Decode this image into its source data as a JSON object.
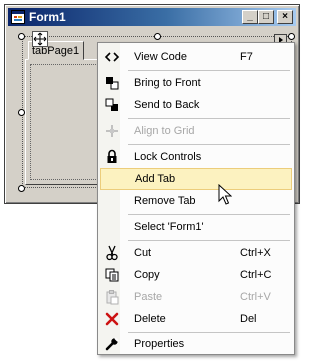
{
  "window": {
    "title": "Form1",
    "buttons": {
      "minimize": "_",
      "maximize": "□",
      "close": "×"
    }
  },
  "designer": {
    "tab_label": "tabPage1"
  },
  "context_menu": {
    "items": [
      {
        "label": "View Code",
        "shortcut": "F7",
        "icon": "view-code-icon",
        "enabled": true
      },
      {
        "label": "Bring to Front",
        "shortcut": "",
        "icon": "bring-to-front-icon",
        "enabled": true
      },
      {
        "label": "Send to Back",
        "shortcut": "",
        "icon": "send-to-back-icon",
        "enabled": true
      },
      {
        "label": "Align to Grid",
        "shortcut": "",
        "icon": "align-to-grid-icon",
        "enabled": false
      },
      {
        "label": "Lock Controls",
        "shortcut": "",
        "icon": "lock-icon",
        "enabled": true
      },
      {
        "label": "Add Tab",
        "shortcut": "",
        "icon": "",
        "enabled": true,
        "highlighted": true
      },
      {
        "label": "Remove Tab",
        "shortcut": "",
        "icon": "",
        "enabled": true
      },
      {
        "label": "Select 'Form1'",
        "shortcut": "",
        "icon": "",
        "enabled": true
      },
      {
        "label": "Cut",
        "shortcut": "Ctrl+X",
        "icon": "scissors-icon",
        "enabled": true
      },
      {
        "label": "Copy",
        "shortcut": "Ctrl+C",
        "icon": "copy-icon",
        "enabled": true
      },
      {
        "label": "Paste",
        "shortcut": "Ctrl+V",
        "icon": "paste-icon",
        "enabled": false
      },
      {
        "label": "Delete",
        "shortcut": "Del",
        "icon": "delete-icon",
        "enabled": true
      },
      {
        "label": "Properties",
        "shortcut": "",
        "icon": "wrench-icon",
        "enabled": true
      }
    ]
  },
  "colors": {
    "title_gradient_start": "#0a246a",
    "title_gradient_end": "#a6caf0",
    "hover_background": "#fcf2c0",
    "delete_icon": "#cc1111"
  }
}
